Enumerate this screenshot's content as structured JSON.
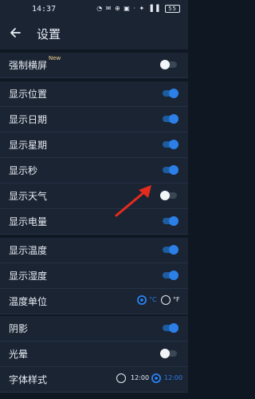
{
  "status": {
    "time": "14:37",
    "icons": "◔ ✉ ⊕ ▣ ·  ✦ ▐ ▌",
    "battery": "55"
  },
  "header": {
    "title": "设置",
    "back_icon": "back-arrow-icon"
  },
  "sections": {
    "s1": [
      {
        "label": "强制横屏",
        "badge": "New",
        "state": "off"
      }
    ],
    "s2": [
      {
        "label": "显示位置",
        "state": "on"
      },
      {
        "label": "显示日期",
        "state": "on"
      },
      {
        "label": "显示星期",
        "state": "on"
      },
      {
        "label": "显示秒",
        "state": "on"
      },
      {
        "label": "显示天气",
        "state": "off"
      },
      {
        "label": "显示电量",
        "state": "on"
      }
    ],
    "s3": [
      {
        "label": "显示温度",
        "state": "on"
      },
      {
        "label": "显示湿度",
        "state": "on"
      }
    ],
    "temp": {
      "label": "温度单位",
      "options": [
        "°C",
        "°F"
      ],
      "selected": "°C"
    },
    "s4": [
      {
        "label": "阴影",
        "state": "on"
      },
      {
        "label": "光晕",
        "state": "off"
      }
    ],
    "font": {
      "label": "字体样式",
      "options": [
        "12:00",
        "12:00"
      ],
      "selected_index": 1
    }
  },
  "colors": {
    "accent": "#2b7fe6",
    "annotation_arrow": "#e52b1e"
  }
}
